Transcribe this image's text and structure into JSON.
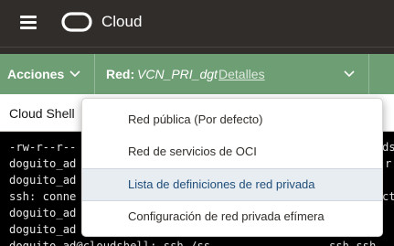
{
  "header": {
    "brand": "Cloud"
  },
  "action_bar": {
    "acciones_label": "Acciones",
    "red_label": "Red:",
    "red_value": "VCN_PRI_dgt",
    "details_link": "Detalles"
  },
  "tab": {
    "label": "Cloud Shell"
  },
  "terminal": {
    "lines": [
      "-rw-r--r--",
      "doguito_ad",
      "doguito_ad",
      "ssh: conne",
      "doguito_ad",
      "doguito_ad",
      "doguito_ad@cloudshell: ssh /ss"
    ],
    "right_fragments": [
      "ds",
      "r",
      "",
      "ct",
      "",
      "",
      "ssh ssh"
    ]
  },
  "dropdown": {
    "items": [
      "Red pública  (Por defecto)",
      "Red de servicios de OCI",
      "Lista de definiciones de red privada",
      "Configuración de red privada efímera"
    ],
    "selected_index": 2
  },
  "colors": {
    "topbar": "#312d2a",
    "action_bar": "#6e9e74",
    "selected_item": "#e8edf2"
  }
}
